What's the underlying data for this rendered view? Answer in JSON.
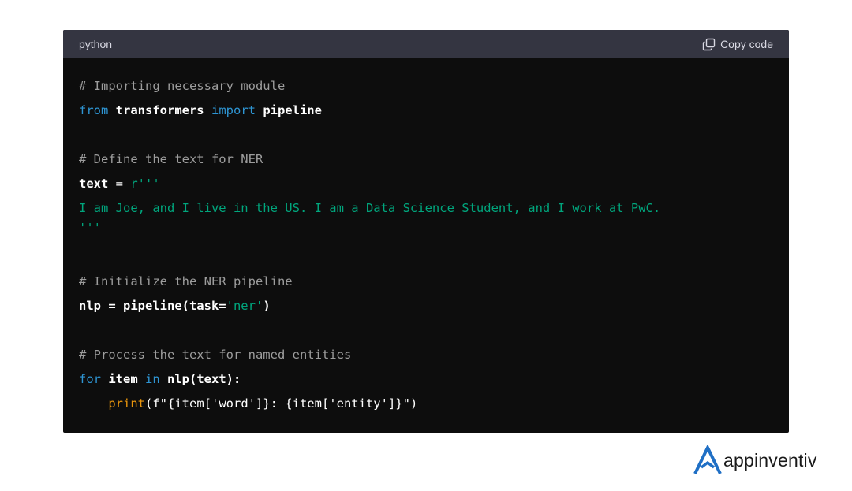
{
  "header": {
    "language": "python",
    "copy_label": "Copy code"
  },
  "code": {
    "l1": "# Importing necessary module",
    "l2_kw1": "from",
    "l2_mod": " transformers ",
    "l2_kw2": "import",
    "l2_name": " pipeline",
    "l4": "# Define the text for NER",
    "l5_var": "text",
    "l5_eq": " = ",
    "l5_str": "r'''",
    "l6": "I am Joe, and I live in the US. I am a Data Science Student, and I work at PwC.",
    "l7": "'''",
    "l10": "# Initialize the NER pipeline",
    "l11_pre": "nlp = pipeline(task=",
    "l11_str": "'ner'",
    "l11_post": ")",
    "l13": "# Process the text for named entities",
    "l14_kw1": "for",
    "l14_item": " item ",
    "l14_kw2": "in",
    "l14_rest": " nlp(text):",
    "l15_indent": "    ",
    "l15_fn": "print",
    "l15_rest": "(f\"{item['word']}: {item['entity']}\")"
  },
  "brand": {
    "name": "appinventiv",
    "logo_icon": "appinventiv-a-icon",
    "logo_color": "#1f6fc5"
  },
  "colors": {
    "code_bg": "#0d0d0d",
    "header_bg": "#343541",
    "comment": "#9d9d9d",
    "keyword": "#2e95d3",
    "string": "#00a67d",
    "builtin": "#e9950c"
  }
}
